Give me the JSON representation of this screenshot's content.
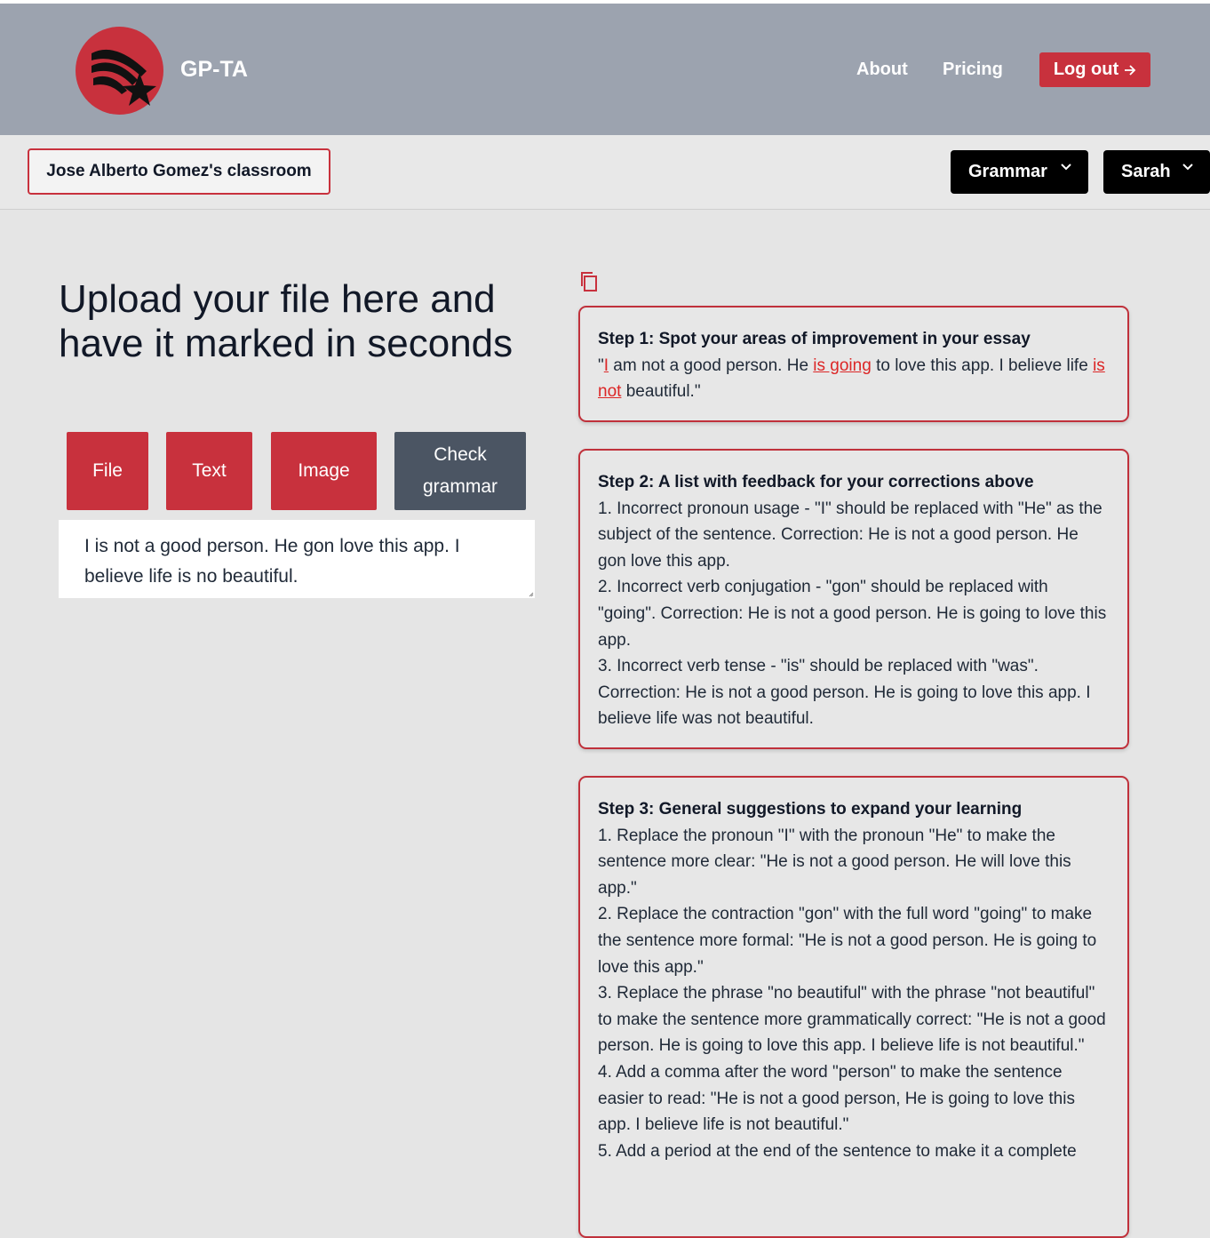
{
  "header": {
    "brand": "GP-TA",
    "nav": {
      "about": "About",
      "pricing": "Pricing",
      "logout": "Log out"
    }
  },
  "subbar": {
    "classroom": "Jose Alberto Gomez's classroom",
    "mode_dropdown": "Grammar",
    "user_dropdown": "Sarah"
  },
  "main": {
    "headline": "Upload your file here and have it marked in seconds",
    "buttons": {
      "file": "File",
      "text": "Text",
      "image": "Image",
      "check": "Check grammar"
    },
    "input_text": "I is not a good person. He gon love this app. I believe life is no beautiful."
  },
  "results": {
    "step1": {
      "title": "Step 1: Spot your areas of improvement in your essay",
      "segments": [
        {
          "text": "\"",
          "error": false
        },
        {
          "text": "I",
          "error": true
        },
        {
          "text": " am not a good person. He ",
          "error": false
        },
        {
          "text": "is going",
          "error": true
        },
        {
          "text": " to love this app. I believe life ",
          "error": false
        },
        {
          "text": "is not",
          "error": true
        },
        {
          "text": " beautiful.\"",
          "error": false
        }
      ]
    },
    "step2": {
      "title": "Step 2: A list with feedback for your corrections above",
      "items": [
        "1. Incorrect pronoun usage - \"I\" should be replaced with \"He\" as the subject of the sentence. Correction: He is not a good person. He gon love this app.",
        "2. Incorrect verb conjugation - \"gon\" should be replaced with \"going\". Correction: He is not a good person. He is going to love this app.",
        "3. Incorrect verb tense - \"is\" should be replaced with \"was\". Correction: He is not a good person. He is going to love this app. I believe life was not beautiful."
      ]
    },
    "step3": {
      "title": "Step 3: General suggestions to expand your learning",
      "items": [
        "1. Replace the pronoun \"I\" with the pronoun \"He\" to make the sentence more clear: \"He is not a good person. He will love this app.\"",
        "2. Replace the contraction \"gon\" with the full word \"going\" to make the sentence more formal: \"He is not a good person. He is going to love this app.\"",
        "3. Replace the phrase \"no beautiful\" with the phrase \"not beautiful\" to make the sentence more grammatically correct: \"He is not a good person. He is going to love this app. I believe life is not beautiful.\"",
        "4. Add a comma after the word \"person\" to make the sentence easier to read: \"He is not a good person, He is going to love this app. I believe life is not beautiful.\"",
        "5. Add a period at the end of the sentence to make it a complete"
      ]
    }
  },
  "icons": {
    "logo": "shooting-star-logo",
    "logout": "arrow-right-icon",
    "dropdown": "chevron-down-icon",
    "copy": "copy-icon"
  },
  "colors": {
    "accent_red": "#c8313d",
    "header_gray": "#9ca3af",
    "check_button": "#4b5563",
    "error_text": "#dc2626"
  }
}
